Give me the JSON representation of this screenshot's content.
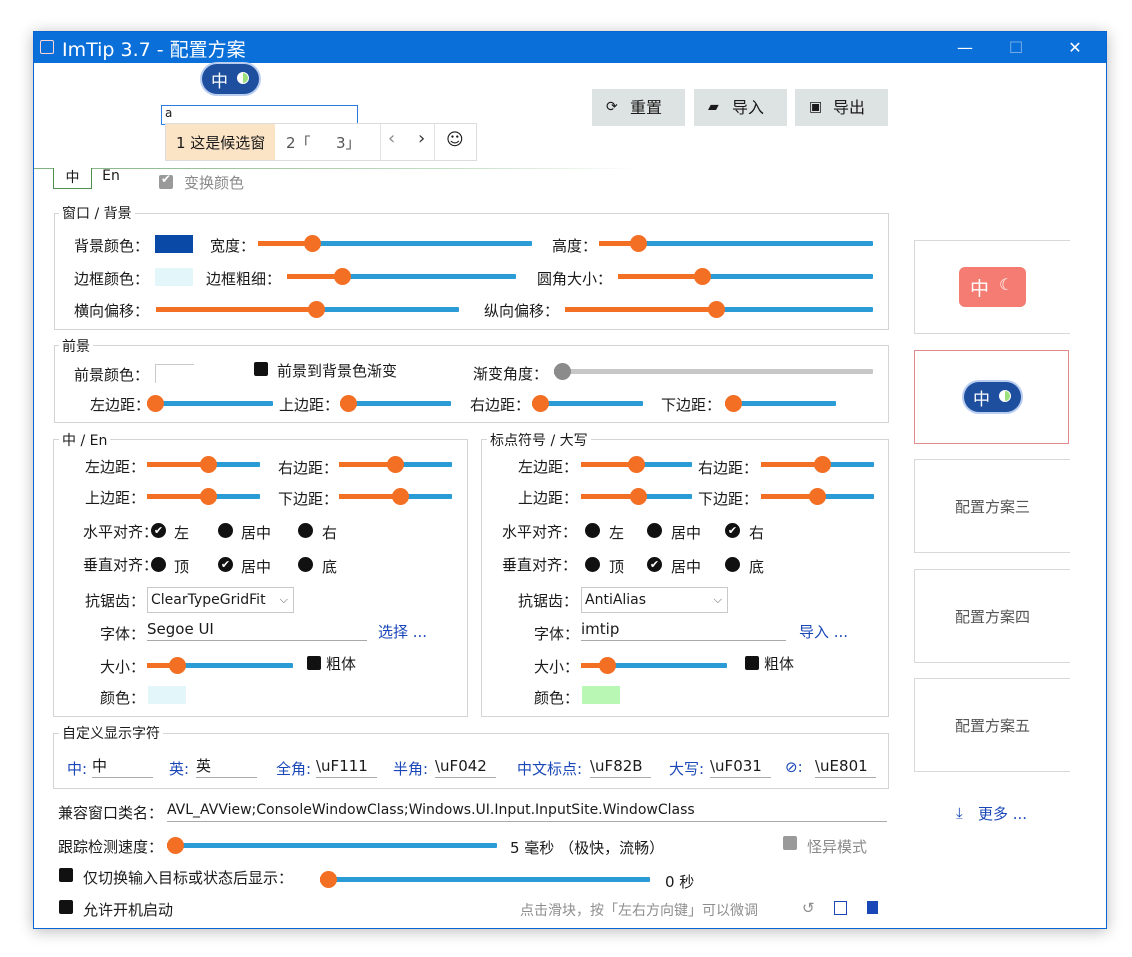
{
  "window": {
    "title": "ImTip 3.7 - 配置方案",
    "minimize": "—",
    "maximize": "☐",
    "close": "✕"
  },
  "preview": {
    "zh": "中",
    "input_char": "a"
  },
  "candidate": {
    "item1": "1 这是候选窗",
    "item2": "2「",
    "item3": "3」",
    "prev": "‹",
    "next": "›",
    "emoji": "☺"
  },
  "toolbar": {
    "reset": "重置",
    "import": "导入",
    "export": "导出"
  },
  "tabs": {
    "zh": "中",
    "en": "En"
  },
  "swap_colors": {
    "label": "变换颜色",
    "checked": true
  },
  "window_bg": {
    "title": "窗口 / 背景",
    "bg_color_label": "背景颜色：",
    "bg_color": "#0a4aa6",
    "width_label": "宽度：",
    "width_value": 0.18,
    "height_label": "高度：",
    "height_value": 0.12,
    "border_color_label": "边框颜色：",
    "border_color": "#e3f7fa",
    "border_width_label": "边框粗细：",
    "border_width_value": 0.22,
    "radius_label": "圆角大小：",
    "radius_value": 0.32,
    "offset_x_label": "横向偏移：",
    "offset_x_value": 0.53,
    "offset_y_label": "纵向偏移：",
    "offset_y_value": 0.49
  },
  "foreground": {
    "title": "前景",
    "fg_color_label": "前景颜色：",
    "fg_color": "#ffffff",
    "gradient_label": "前景到背景色渐变",
    "angle_label": "渐变角度：",
    "angle_value": 0.0,
    "left_label": "左边距：",
    "left_value": 0.0,
    "top_label": "上边距：",
    "top_value": 0.0,
    "right_label": "右边距：",
    "right_value": 0.0,
    "bottom_label": "下边距：",
    "bottom_value": 0.0
  },
  "zh_en": {
    "title": "中 / En",
    "left_label": "左边距：",
    "left_value": 0.55,
    "right_label": "右边距：",
    "right_value": 0.5,
    "top_label": "上边距：",
    "top_value": 0.55,
    "bottom_label": "下边距：",
    "bottom_value": 0.55,
    "halign_label": "水平对齐：",
    "halign_options": [
      "左",
      "居中",
      "右"
    ],
    "halign_selected": 0,
    "valign_label": "垂直对齐：",
    "valign_options": [
      "顶",
      "居中",
      "底"
    ],
    "valign_selected": 1,
    "aa_label": "抗锯齿：",
    "aa_value": "ClearTypeGridFit",
    "font_label": "字体：",
    "font_value": "Segoe UI",
    "font_action": "选择 ...",
    "size_label": "大小：",
    "size_value": 0.17,
    "bold_label": "粗体",
    "color_label": "颜色：",
    "color": "#e3f7fa"
  },
  "punct_caps": {
    "title": "标点符号 / 大写",
    "left_label": "左边距：",
    "left_value": 0.5,
    "right_label": "右边距：",
    "right_value": 0.55,
    "top_label": "上边距：",
    "top_value": 0.52,
    "bottom_label": "下边距：",
    "bottom_value": 0.5,
    "halign_label": "水平对齐：",
    "halign_options": [
      "左",
      "居中",
      "右"
    ],
    "halign_selected": 2,
    "valign_label": "垂直对齐：",
    "valign_options": [
      "顶",
      "居中",
      "底"
    ],
    "valign_selected": 1,
    "aa_label": "抗锯齿：",
    "aa_value": "AntiAlias",
    "font_label": "字体：",
    "font_value": "imtip",
    "font_action": "导入 ...",
    "size_label": "大小：",
    "size_value": 0.14,
    "bold_label": "粗体",
    "color_label": "颜色：",
    "color": "#b9f7b5"
  },
  "custom_chars": {
    "title": "自定义显示字符",
    "zh_label": "中:",
    "zh_value": "中",
    "en_label": "英:",
    "en_value": "英",
    "full_label": "全角:",
    "full_value": "\\uF111",
    "half_label": "半角:",
    "half_value": "\\uF042",
    "cn_punct_label": "中文标点:",
    "cn_punct_value": "\\uF82B",
    "caps_label": "大写:",
    "caps_value": "\\uF031",
    "disabled_label": "⊘:",
    "disabled_value": "\\uE801"
  },
  "compat": {
    "label": "兼容窗口类名：",
    "value": "AVL_AVView;ConsoleWindowClass;Windows.UI.Input.InputSite.WindowClass"
  },
  "tracking": {
    "label": "跟踪检测速度：",
    "value": 0.0,
    "text": "5 毫秒 （极快，流畅）"
  },
  "weird_mode": {
    "label": "怪异模式"
  },
  "switch_only": {
    "label": "仅切换输入目标或状态后显示：",
    "value": 0.0,
    "text": "0 秒"
  },
  "autostart": {
    "label": "允许开机启动"
  },
  "hint": "点击滑块，按「左右方向键」可以微调",
  "schemes": {
    "s3": "配置方案三",
    "s4": "配置方案四",
    "s5": "配置方案五",
    "more": "更多 ..."
  },
  "scheme1": {
    "zh": "中",
    "bg": "#f47c72"
  },
  "colors": {
    "accent": "#0a6fd8",
    "slider_fill": "#f26f24",
    "slider_track": "#2a9bd4"
  }
}
